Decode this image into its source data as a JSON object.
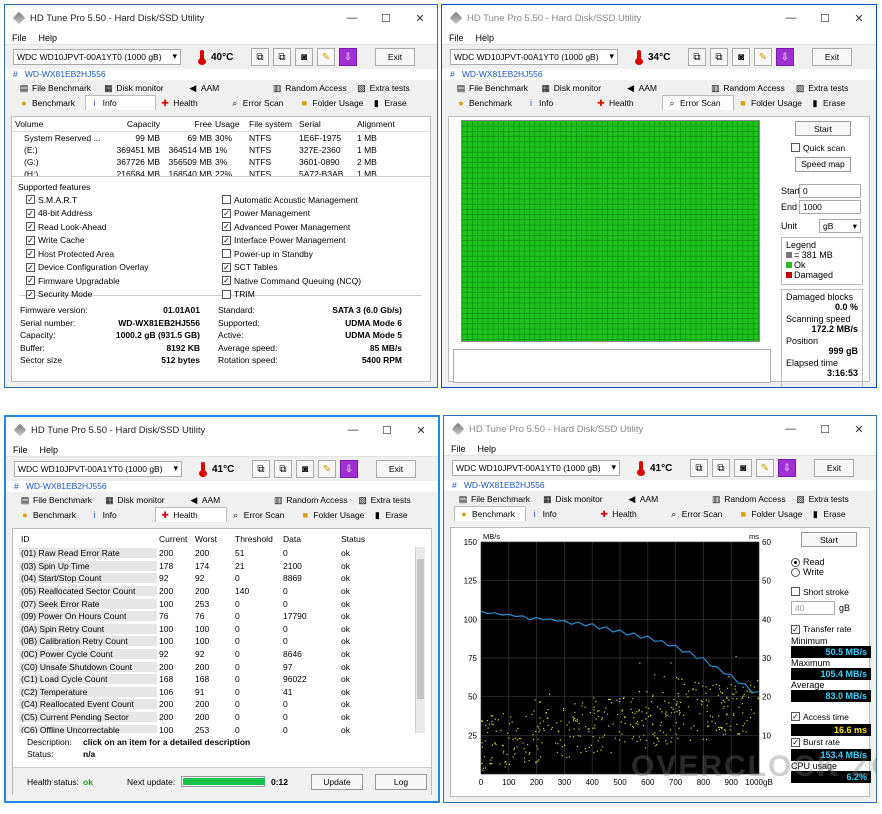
{
  "app": {
    "title": "HD Tune Pro 5.50 - Hard Disk/SSD Utility",
    "menu": [
      "File",
      "Help"
    ],
    "drive": "WDC WD10JPVT-00A1YT0 (1000 gB)",
    "serial_tag": "WD-WX81EB2HJ556",
    "exit_label": "Exit",
    "tabs_row1": [
      "File Benchmark",
      "Disk monitor",
      "AAM",
      "Random Access",
      "Extra tests"
    ],
    "tabs_row2": [
      "Benchmark",
      "Info",
      "Health",
      "Error Scan",
      "Folder Usage",
      "Erase"
    ],
    "window_buttons": [
      "—",
      "☐",
      "✕"
    ],
    "serial_hash": "#"
  },
  "colors": {
    "accent": "#2b6db0",
    "scan_ok": "#1ec21e",
    "legend_damaged": "#c00000",
    "read_line": "#2a8fd4",
    "access_dots": "#d9d43a"
  },
  "info": {
    "temp": "40°C",
    "columns": [
      "Volume",
      "Capacity",
      "Free",
      "Usage",
      "File system",
      "Serial",
      "Alignment"
    ],
    "volumes": [
      [
        "System Reserved ...",
        "99 MB",
        "69 MB",
        "30%",
        "NTFS",
        "1E6F-1975",
        "1 MB"
      ],
      [
        "(E:)",
        "369451 MB",
        "364514 MB",
        "1%",
        "NTFS",
        "327E-2360",
        "1 MB"
      ],
      [
        "(G:)",
        "367726 MB",
        "356509 MB",
        "3%",
        "NTFS",
        "3601-0890",
        "2 MB"
      ],
      [
        "(H:)",
        "216584 MB",
        "168540 MB",
        "22%",
        "NTFS",
        "5A72-B3AB",
        "1 MB"
      ]
    ],
    "features_label": "Supported features",
    "features_left": [
      {
        "label": "S.M.A.R.T",
        "checked": true
      },
      {
        "label": "48-bit Address",
        "checked": true
      },
      {
        "label": "Read Look-Ahead",
        "checked": true
      },
      {
        "label": "Write Cache",
        "checked": true
      },
      {
        "label": "Host Protected Area",
        "checked": true
      },
      {
        "label": "Device Configuration Overlay",
        "checked": true
      },
      {
        "label": "Firmware Upgradable",
        "checked": true
      },
      {
        "label": "Security Mode",
        "checked": true
      }
    ],
    "features_right": [
      {
        "label": "Automatic Acoustic Management",
        "checked": false
      },
      {
        "label": "Power Management",
        "checked": true
      },
      {
        "label": "Advanced Power Management",
        "checked": true
      },
      {
        "label": "Interface Power Management",
        "checked": true
      },
      {
        "label": "Power-up in Standby",
        "checked": false
      },
      {
        "label": "SCT Tables",
        "checked": true
      },
      {
        "label": "Native Command Queuing (NCQ)",
        "checked": true
      },
      {
        "label": "TRIM",
        "checked": false
      }
    ],
    "details_left": [
      [
        "Firmware version:",
        "01.01A01"
      ],
      [
        "Serial number:",
        "WD-WX81EB2HJ556"
      ],
      [
        "Capacity:",
        "1000.2 gB (931.5 GB)"
      ],
      [
        "Buffer:",
        "8192 KB"
      ],
      [
        "Sector size",
        "512 bytes"
      ]
    ],
    "details_right": [
      [
        "Standard:",
        "SATA 3 (6.0 Gb/s)"
      ],
      [
        "Supported:",
        "UDMA Mode 6"
      ],
      [
        "Active:",
        "UDMA Mode 5"
      ],
      [
        "Average speed:",
        "85 MB/s"
      ],
      [
        "Rotation speed:",
        "5400 RPM"
      ]
    ]
  },
  "errorscan": {
    "temp": "34°C",
    "start_btn": "Start",
    "quick_scan": "Quick scan",
    "speed_map": "Speed map",
    "start_label": "Start",
    "start_val": "0",
    "end_label": "End",
    "end_val": "1000",
    "unit_label": "Unit",
    "unit_val": "gB",
    "legend_title": "Legend",
    "legend": [
      "= 381 MB",
      "Ok",
      "Damaged"
    ],
    "damaged_label": "Damaged blocks",
    "damaged_val": "0.0 %",
    "speed_label": "Scanning speed",
    "speed_val": "172.2 MB/s",
    "position_label": "Position",
    "position_val": "999 gB",
    "elapsed_label": "Elapsed time",
    "elapsed_val": "3:16:53",
    "blocks_ok_percent": 100
  },
  "health": {
    "temp": "41°C",
    "columns": [
      "ID",
      "Current",
      "Worst",
      "Threshold",
      "Data",
      "Status"
    ],
    "rows": [
      [
        "(01) Raw Read Error Rate",
        "200",
        "200",
        "51",
        "0",
        "ok"
      ],
      [
        "(03) Spin Up Time",
        "178",
        "174",
        "21",
        "2100",
        "ok"
      ],
      [
        "(04) Start/Stop Count",
        "92",
        "92",
        "0",
        "8869",
        "ok"
      ],
      [
        "(05) Reallocated Sector Count",
        "200",
        "200",
        "140",
        "0",
        "ok"
      ],
      [
        "(07) Seek Error Rate",
        "100",
        "253",
        "0",
        "0",
        "ok"
      ],
      [
        "(09) Power On Hours Count",
        "76",
        "76",
        "0",
        "17790",
        "ok"
      ],
      [
        "(0A) Spin Retry Count",
        "100",
        "100",
        "0",
        "0",
        "ok"
      ],
      [
        "(0B) Calibration Retry Count",
        "100",
        "100",
        "0",
        "0",
        "ok"
      ],
      [
        "(0C) Power Cycle Count",
        "92",
        "92",
        "0",
        "8646",
        "ok"
      ],
      [
        "(C0) Unsafe Shutdown Count",
        "200",
        "200",
        "0",
        "97",
        "ok"
      ],
      [
        "(C1) Load Cycle Count",
        "168",
        "168",
        "0",
        "96022",
        "ok"
      ],
      [
        "(C2) Temperature",
        "106",
        "91",
        "0",
        "41",
        "ok"
      ],
      [
        "(C4) Reallocated Event Count",
        "200",
        "200",
        "0",
        "0",
        "ok"
      ],
      [
        "(C5) Current Pending Sector",
        "200",
        "200",
        "0",
        "0",
        "ok"
      ],
      [
        "(C6) Offline Uncorrectable",
        "100",
        "253",
        "0",
        "0",
        "ok"
      ]
    ],
    "desc_label": "Description:",
    "desc_val": "click on an item for a detailed description",
    "status_label": "Status:",
    "status_val": "n/a",
    "health_label": "Health status:",
    "health_val": "ok",
    "next_label": "Next update:",
    "next_val": "0:12",
    "next_progress": 1.0,
    "update_btn": "Update",
    "log_btn": "Log"
  },
  "benchmark": {
    "temp": "41°C",
    "start_btn": "Start",
    "read_label": "Read",
    "write_label": "Write",
    "mode": "read",
    "short_stroke": "Short stroke",
    "short_stroke_checked": false,
    "stroke_val": "40",
    "stroke_unit": "gB",
    "transfer_rate": "Transfer rate",
    "transfer_rate_checked": true,
    "min_label": "Minimum",
    "min_val": "50.5 MB/s",
    "max_label": "Maximum",
    "max_val": "105.4 MB/s",
    "avg_label": "Average",
    "avg_val": "83.0 MB/s",
    "access_label": "Access time",
    "access_checked": true,
    "access_val": "16.6 ms",
    "burst_label": "Burst rate",
    "burst_checked": true,
    "burst_val": "153.4 MB/s",
    "cpu_label": "CPU usage",
    "cpu_val": "6.2%"
  },
  "chart_data": {
    "type": "line",
    "ylabel": "MB/s",
    "y2label": "ms",
    "ylim": [
      0,
      150
    ],
    "y2lim": [
      0,
      60
    ],
    "xlim": [
      0,
      1000
    ],
    "x_unit": "gB",
    "yticks": [
      "150",
      "125",
      "100",
      "75",
      "50",
      "25"
    ],
    "y2ticks": [
      "60",
      "50",
      "40",
      "30",
      "20",
      "10"
    ],
    "xticks": [
      "0",
      "100",
      "200",
      "300",
      "400",
      "500",
      "600",
      "700",
      "800",
      "900",
      "1000gB"
    ],
    "grid": true,
    "series": [
      {
        "name": "Read",
        "x": [
          0,
          25,
          50,
          75,
          100,
          125,
          150,
          175,
          200,
          225,
          250,
          275,
          300,
          325,
          350,
          375,
          400,
          425,
          450,
          475,
          500,
          525,
          550,
          575,
          600,
          625,
          650,
          675,
          700,
          725,
          750,
          775,
          800,
          825,
          850,
          875,
          900,
          925,
          950,
          975,
          1000
        ],
        "values": [
          104,
          105,
          103,
          104,
          102,
          103,
          101,
          101,
          100,
          101,
          99,
          100,
          98,
          98,
          97,
          97,
          96,
          95,
          94,
          93,
          92,
          91,
          90,
          89,
          88,
          87,
          85,
          84,
          82,
          80,
          78,
          76,
          74,
          71,
          68,
          66,
          63,
          60,
          57,
          54,
          52
        ]
      }
    ],
    "access_time_ms_mean": 16.6,
    "access_time_ms_range": [
      8,
      28
    ]
  },
  "watermark": "OVERCLOCK ZONE"
}
